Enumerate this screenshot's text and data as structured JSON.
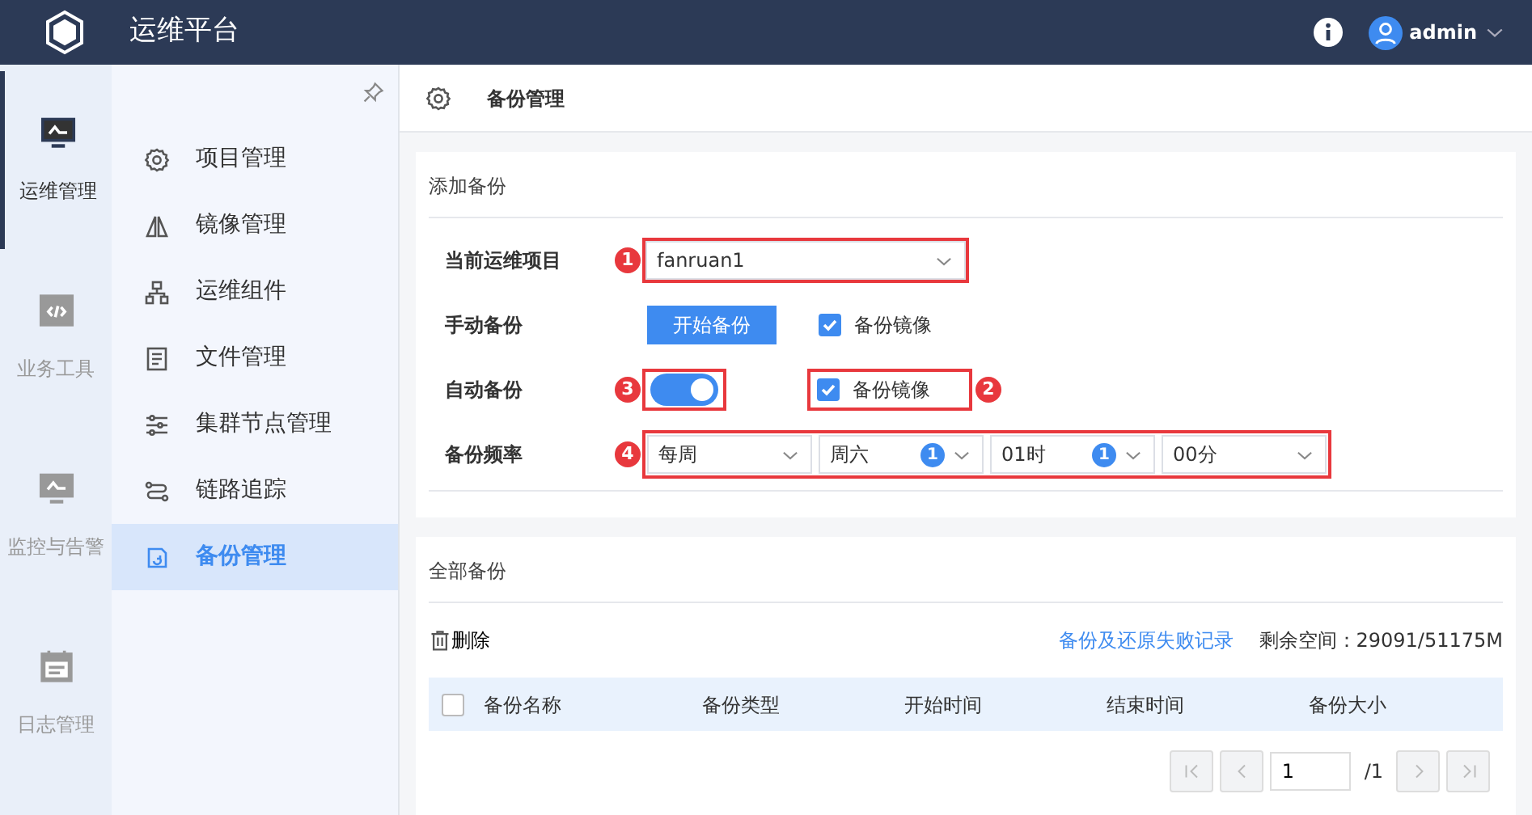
{
  "header": {
    "title": "运维平台",
    "user": "admin"
  },
  "rail": [
    {
      "label": "运维管理",
      "selected": true
    },
    {
      "label": "业务工具",
      "selected": false
    },
    {
      "label": "监控与告警",
      "selected": false
    },
    {
      "label": "日志管理",
      "selected": false
    }
  ],
  "menu": [
    {
      "label": "项目管理",
      "selected": false
    },
    {
      "label": "镜像管理",
      "selected": false
    },
    {
      "label": "运维组件",
      "selected": false
    },
    {
      "label": "文件管理",
      "selected": false
    },
    {
      "label": "集群节点管理",
      "selected": false
    },
    {
      "label": "链路追踪",
      "selected": false
    },
    {
      "label": "备份管理",
      "selected": true
    }
  ],
  "breadcrumb": "备份管理",
  "add_backup": {
    "title": "添加备份",
    "project": {
      "label": "当前运维项目",
      "value": "fanruan1",
      "callout": "1"
    },
    "manual": {
      "label": "手动备份",
      "button": "开始备份",
      "checkbox": {
        "label": "备份镜像",
        "checked": true
      }
    },
    "auto": {
      "label": "自动备份",
      "on": true,
      "switch_callout": "3",
      "checkbox": {
        "label": "备份镜像",
        "checked": true
      },
      "checkbox_callout": "2"
    },
    "frequency": {
      "label": "备份频率",
      "callout": "4",
      "selects": [
        {
          "value": "每周"
        },
        {
          "value": "周六",
          "badge": "1"
        },
        {
          "value": "01时",
          "badge": "1"
        },
        {
          "value": "00分"
        }
      ]
    }
  },
  "all_backups": {
    "title": "全部备份",
    "delete": "删除",
    "failure_link": "备份及还原失败记录",
    "space": "剩余空间：29091/51175M",
    "table": {
      "select_all": {
        "checked": false
      },
      "columns": [
        "备份名称",
        "备份类型",
        "开始时间",
        "结束时间",
        "备份大小"
      ]
    },
    "pagination": {
      "page": "1",
      "total": "/1",
      "first_disabled": true,
      "prev_disabled": true,
      "next_disabled": true,
      "last_disabled": true
    }
  }
}
